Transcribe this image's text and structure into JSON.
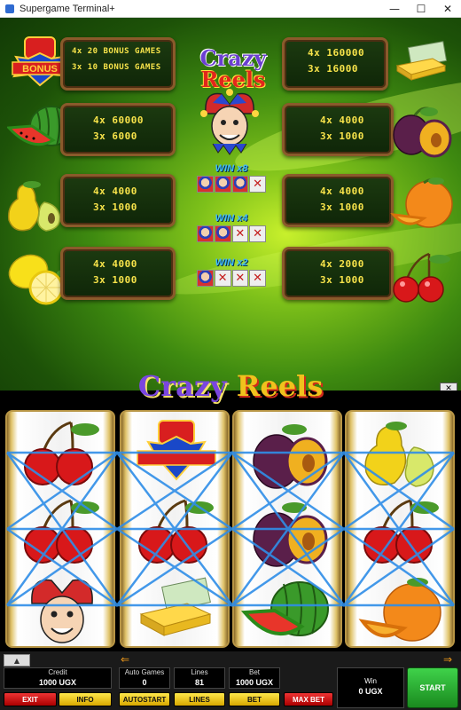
{
  "window": {
    "title": "Supergame Terminal+",
    "minimize": "—",
    "maximize": "☐",
    "close": "✕"
  },
  "paytable": {
    "logo_word1": "Crazy",
    "logo_word2": "Reels",
    "bonus_label": "BONUS",
    "bonus_line1": "4x 20 BONUS GAMES",
    "bonus_line2": "3x 10 BONUS GAMES",
    "gold_line1": "4x  160000",
    "gold_line2": "3x  16000",
    "watermelon_line1": "4x  60000",
    "watermelon_line2": "3x  6000",
    "plum_line1": "4x  4000",
    "plum_line2": "3x  1000",
    "pear_line1": "4x  4000",
    "pear_line2": "3x  1000",
    "orange_line1": "4x  4000",
    "orange_line2": "3x  1000",
    "lemon_line1": "4x  4000",
    "lemon_line2": "3x  1000",
    "cherry_line1": "4x  2000",
    "cherry_line2": "3x  1000",
    "win_x8": "WIN x8",
    "win_x4": "WIN x4",
    "win_x2": "WIN x2"
  },
  "game": {
    "logo_word1": "Crazy",
    "logo_word2": "Reels",
    "reel_symbols": [
      [
        "cherry",
        "cherry",
        "joker"
      ],
      [
        "bonus",
        "cherry",
        "gold"
      ],
      [
        "plum",
        "plum",
        "watermelon"
      ],
      [
        "pear",
        "cherry",
        "orange"
      ]
    ]
  },
  "panel": {
    "credit_label": "Credit",
    "credit_value": "1000 UGX",
    "auto_games_label": "Auto Games",
    "auto_games_value": "0",
    "lines_label": "Lines",
    "lines_value": "81",
    "bet_label": "Bet",
    "bet_value": "1000 UGX",
    "win_label": "Win",
    "win_value": "0 UGX",
    "exit_label": "EXIT",
    "info_label": "INFO",
    "autostart_label": "AUTOSTART",
    "lines_btn_label": "LINES",
    "bet_btn_label": "BET",
    "max_bet_label": "MAX BET",
    "start_label": "START"
  },
  "colors": {
    "accent_red": "#e33333",
    "accent_yellow": "#ffe84a",
    "start_green": "#3fd24a",
    "payout_text": "#f7e34a",
    "payline_blue": "#2f8ee8"
  }
}
